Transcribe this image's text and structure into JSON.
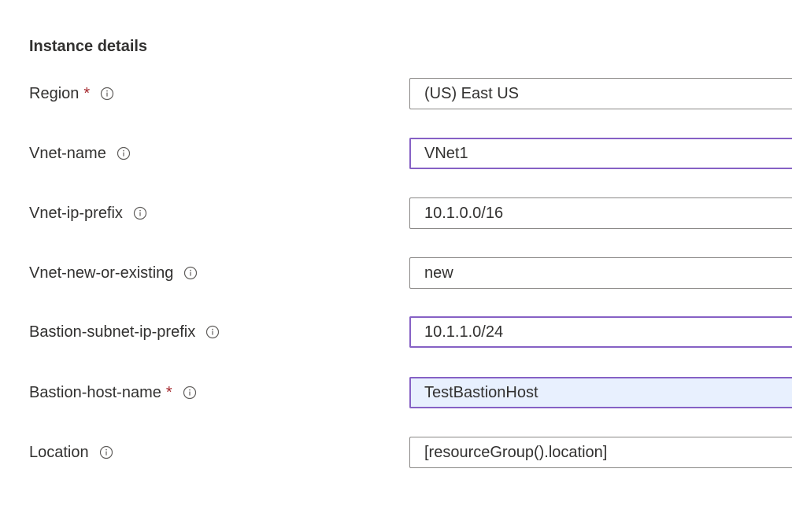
{
  "section": {
    "title": "Instance details"
  },
  "fields": [
    {
      "label": "Region",
      "required": true,
      "value": "(US) East US"
    },
    {
      "label": "Vnet-name",
      "required": false,
      "value": "VNet1"
    },
    {
      "label": "Vnet-ip-prefix",
      "required": false,
      "value": "10.1.0.0/16"
    },
    {
      "label": "Vnet-new-or-existing",
      "required": false,
      "value": "new"
    },
    {
      "label": "Bastion-subnet-ip-prefix",
      "required": false,
      "value": "10.1.1.0/24"
    },
    {
      "label": "Bastion-host-name",
      "required": true,
      "value": "TestBastionHost"
    },
    {
      "label": "Location",
      "required": false,
      "value": "[resourceGroup().location]"
    }
  ],
  "required_marker": "*",
  "icons": {
    "info": "info-icon"
  },
  "colors": {
    "required": "#a4262c",
    "focus_border": "#8661c5",
    "autofill_background": "#e8f0fe",
    "border": "#8a8886"
  }
}
